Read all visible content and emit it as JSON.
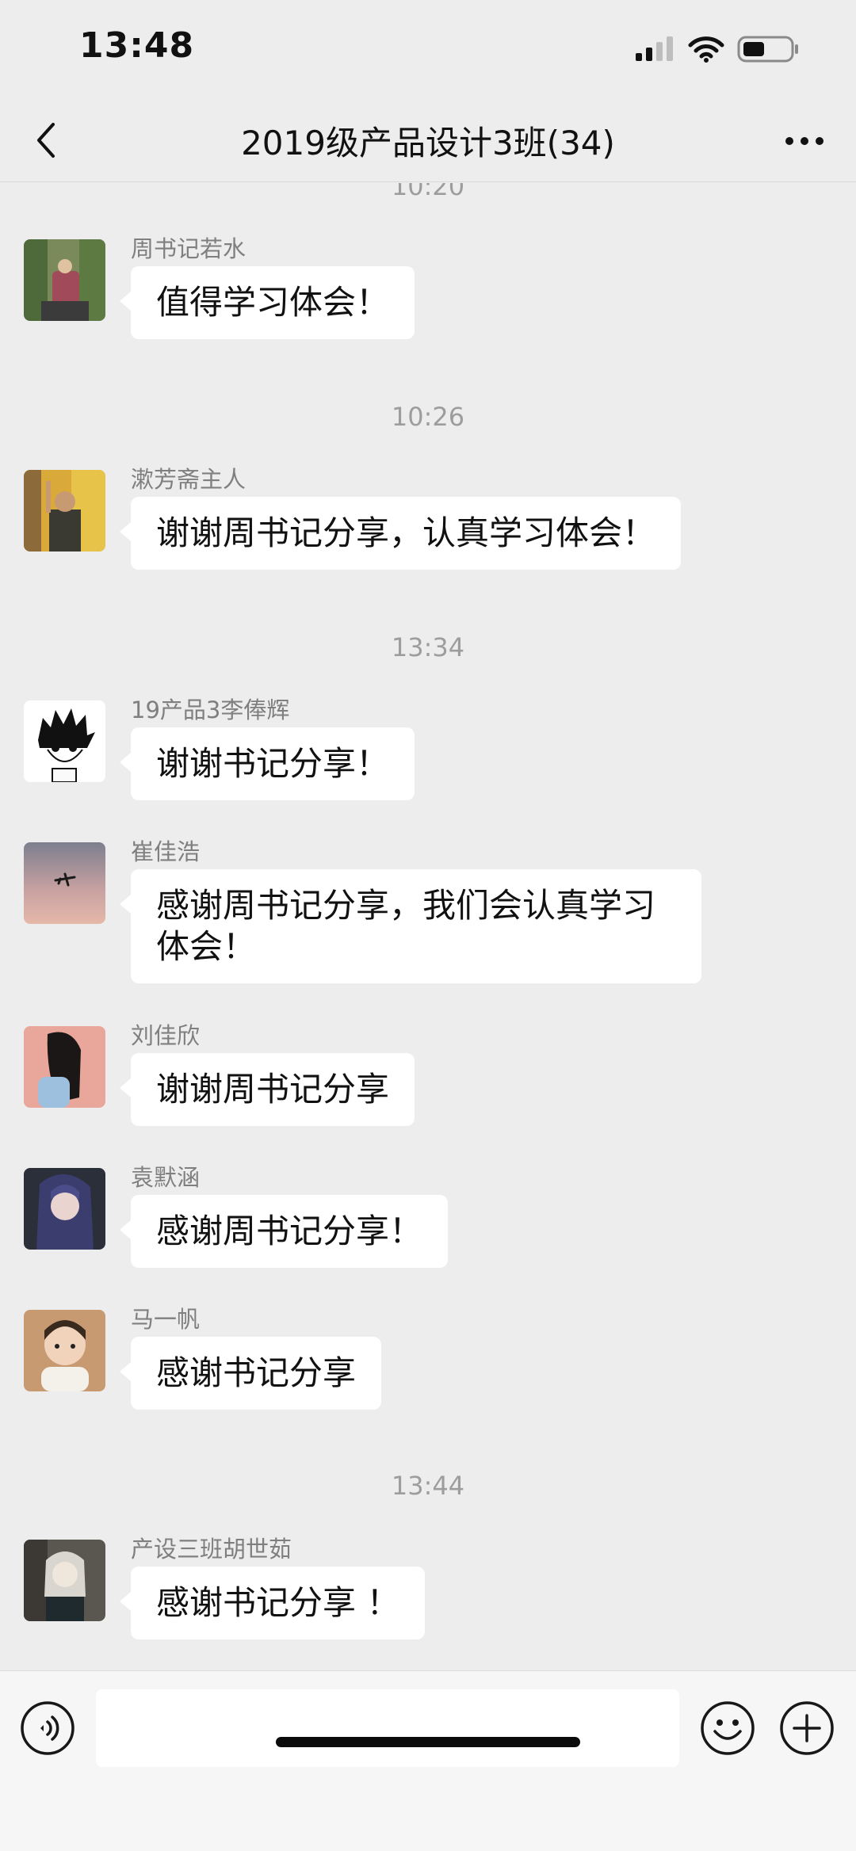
{
  "status_bar": {
    "time": "13:48",
    "icons": [
      "signal-icon",
      "wifi-icon",
      "battery-icon"
    ]
  },
  "header": {
    "title": "2019级产品设计3班(34)",
    "back_icon": "chevron-left-icon",
    "more_icon": "more-icon"
  },
  "chat": {
    "timestamps": [
      "10:20",
      "10:26",
      "13:34",
      "13:44"
    ],
    "messages": [
      {
        "sender": "周书记若水",
        "text": "值得学习体会！"
      },
      {
        "sender": "漱芳斋主人",
        "text": "谢谢周书记分享，认真学习体会！"
      },
      {
        "sender": "19产品3李俸辉",
        "text": "谢谢书记分享！"
      },
      {
        "sender": "崔佳浩",
        "text": "感谢周书记分享，我们会认真学习体会！"
      },
      {
        "sender": "刘佳欣",
        "text": "谢谢周书记分享"
      },
      {
        "sender": "袁默涵",
        "text": "感谢周书记分享！"
      },
      {
        "sender": "马一帆",
        "text": "感谢书记分享"
      },
      {
        "sender": "产设三班胡世茹",
        "text": "感谢书记分享 ！"
      }
    ]
  },
  "input_bar": {
    "text_value": "",
    "icons": [
      "voice-icon",
      "emoji-icon",
      "plus-icon"
    ]
  },
  "colors": {
    "background": "#ededed",
    "bubble": "#ffffff",
    "timestamp": "#9d9d9d",
    "sender": "#7f7f7f"
  }
}
